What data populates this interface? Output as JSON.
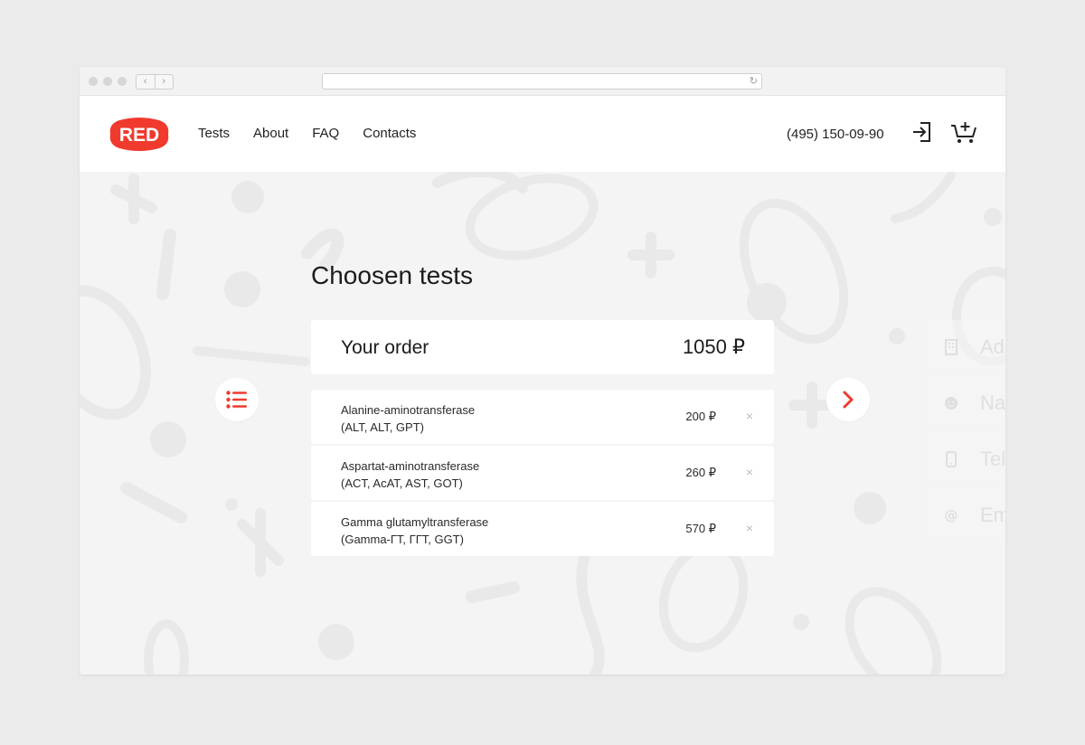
{
  "browser": {
    "back_glyph": "‹",
    "forward_glyph": "›",
    "reload_glyph": "↻"
  },
  "header": {
    "logo_text": "RED",
    "nav": [
      "Tests",
      "About",
      "FAQ",
      "Contacts"
    ],
    "phone": "(495) 150-09-90",
    "icons": [
      "login-icon",
      "cart-plus-icon"
    ]
  },
  "main": {
    "title": "Choosen tests",
    "order": {
      "label": "Your order",
      "total": "1050 ₽"
    },
    "items": [
      {
        "name": "Alanine-aminotransferase",
        "code": "(ALT, ALT, GPT)",
        "price": "200 ₽",
        "remove": "×"
      },
      {
        "name": "Aspartat-aminotransferase",
        "code": "(ACT, AcAT, AST, GOT)",
        "price": "260 ₽",
        "remove": "×"
      },
      {
        "name": "Gamma glutamyltransferase",
        "code": "(Gamma-ГТ, ГГТ, GGT)",
        "price": "570 ₽",
        "remove": "×"
      }
    ]
  },
  "form_preview": {
    "fields": [
      {
        "icon": "building-icon",
        "text": "Ad"
      },
      {
        "icon": "smiley-icon",
        "text": "Na"
      },
      {
        "icon": "phone-icon",
        "text": "Tel"
      },
      {
        "icon": "at-icon",
        "text": "Em"
      }
    ]
  },
  "colors": {
    "accent": "#f03a2e",
    "background": "#f4f4f4",
    "card": "#ffffff",
    "page": "#ebebeb"
  }
}
